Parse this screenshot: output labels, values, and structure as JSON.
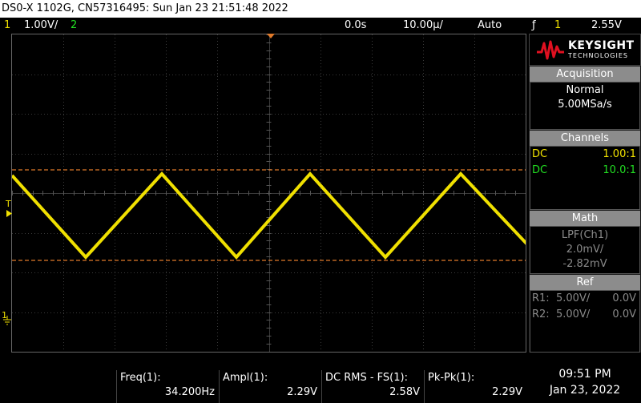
{
  "title": "DS0-X 1102G, CN57316495: Sun Jan 23 21:51:48 2022",
  "status": {
    "ch1_num": "1",
    "ch1_scale": "1.00V/",
    "ch2_num": "2",
    "time_offset": "0.0s",
    "time_scale": "10.00µ/",
    "trigger_mode": "Auto",
    "trigger_icon": "ƒ",
    "trigger_ch": "1",
    "trigger_level": "2.55V"
  },
  "logo": {
    "line1": "KEYSIGHT",
    "line2": "TECHNOLOGIES"
  },
  "acquisition": {
    "header": "Acquisition",
    "mode": "Normal",
    "rate": "5.00MSa/s"
  },
  "channels": {
    "header": "Channels",
    "rows": [
      {
        "coupling": "DC",
        "probe": "1.00:1",
        "color": "#f0e000"
      },
      {
        "coupling": "DC",
        "probe": "10.0:1",
        "color": "#22dd22"
      }
    ]
  },
  "math": {
    "header": "Math",
    "func": "LPF(Ch1)",
    "scale": "2.0mV/",
    "offset": "-2.82mV"
  },
  "ref": {
    "header": "Ref",
    "rows": [
      {
        "name": "R1:",
        "scale": "5.00V/",
        "offset": "0.0V"
      },
      {
        "name": "R2:",
        "scale": "5.00V/",
        "offset": "0.0V"
      }
    ]
  },
  "markers": {
    "trigger_label": "T",
    "ground_label": "1"
  },
  "measurements": [
    {
      "label": "Freq(1):",
      "value": "34.200Hz"
    },
    {
      "label": "Ampl(1):",
      "value": "2.29V"
    },
    {
      "label": "DC RMS - FS(1):",
      "value": "2.58V"
    },
    {
      "label": "Pk-Pk(1):",
      "value": "2.29V"
    }
  ],
  "clock": {
    "time": "09:51 PM",
    "date": "Jan 23, 2022"
  },
  "colors": {
    "ch1": "#f0e000",
    "ch2": "#22dd22",
    "cursor": "#e07a2a",
    "grid": "#3a3a3a"
  }
}
